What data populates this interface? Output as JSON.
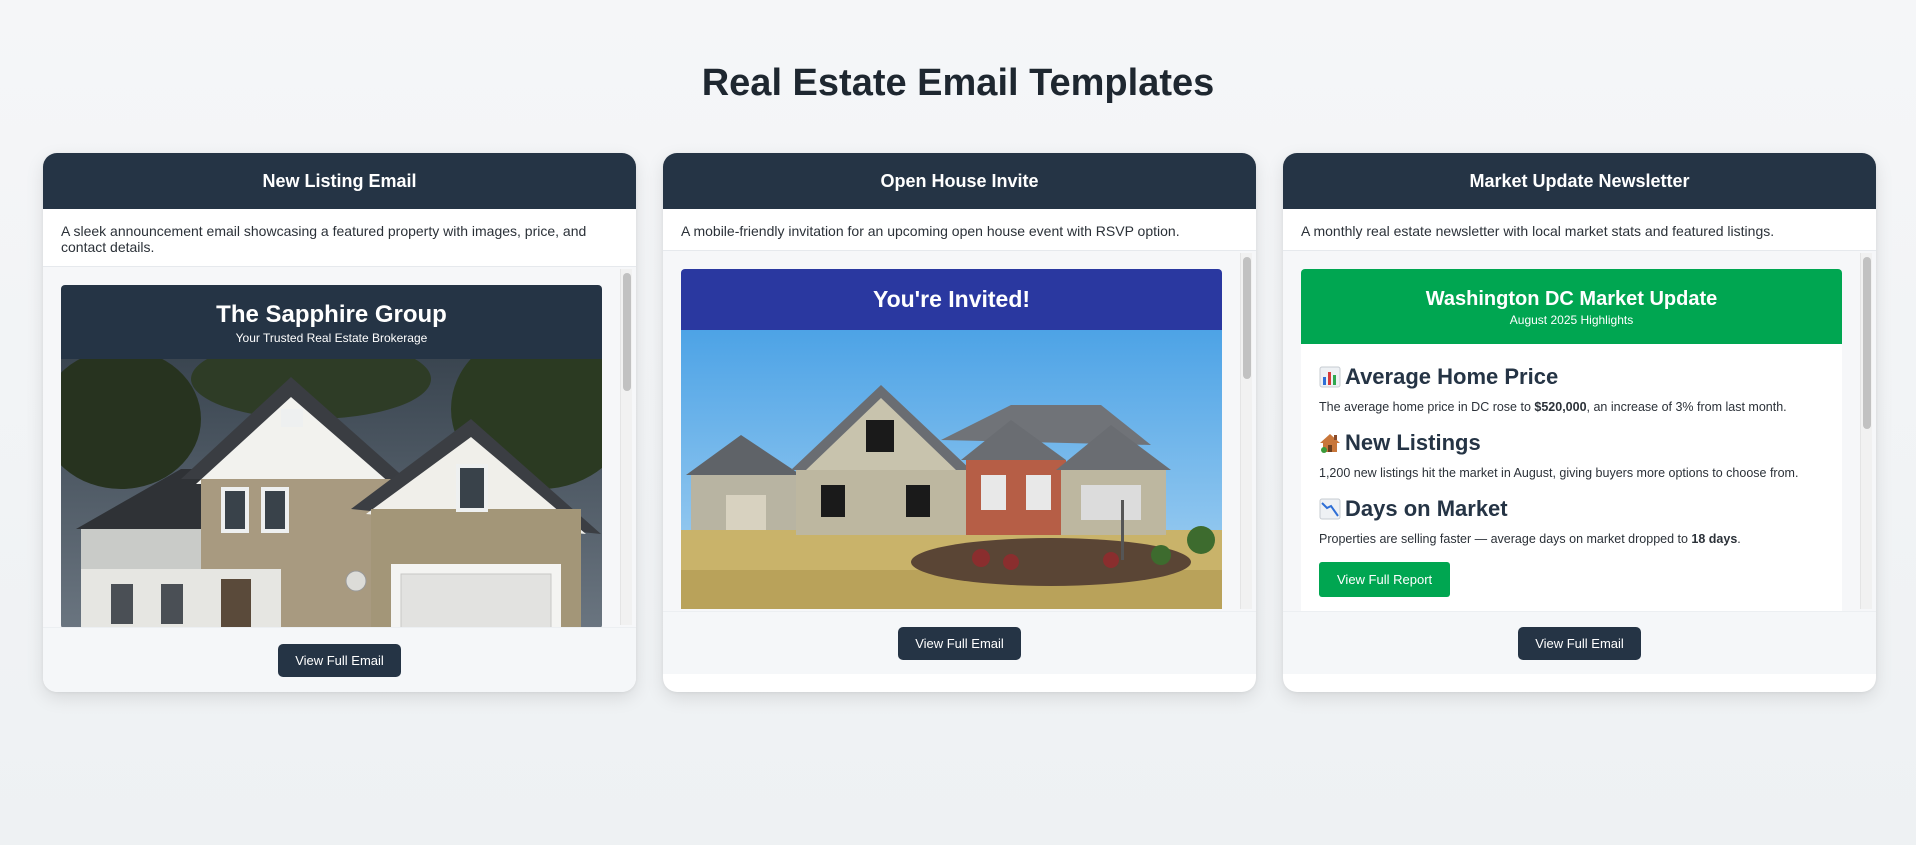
{
  "page": {
    "title": "Real Estate Email Templates"
  },
  "cards": [
    {
      "title": "New Listing Email",
      "description": "A sleek announcement email showcasing a featured property with images, price, and contact details.",
      "email": {
        "brand": "The Sapphire Group",
        "tagline": "Your Trusted Real Estate Brokerage"
      },
      "button": "View Full Email"
    },
    {
      "title": "Open House Invite",
      "description": "A mobile-friendly invitation for an upcoming open house event with RSVP option.",
      "email": {
        "heading": "You're Invited!"
      },
      "button": "View Full Email"
    },
    {
      "title": "Market Update Newsletter",
      "description": "A monthly real estate newsletter with local market stats and featured listings.",
      "email": {
        "heading": "Washington DC Market Update",
        "subheading": "August 2025 Highlights",
        "sections": [
          {
            "icon": "bar-chart-icon",
            "title": "Average Home Price",
            "text_before": "The average home price in DC rose to ",
            "bold": "$520,000",
            "text_after": ", an increase of 3% from last month."
          },
          {
            "icon": "house-icon",
            "title": "New Listings",
            "text_before": "1,200 new listings hit the market in August, giving buyers more options to choose from.",
            "bold": "",
            "text_after": ""
          },
          {
            "icon": "chart-down-icon",
            "title": "Days on Market",
            "text_before": "Properties are selling faster — average days on market dropped to ",
            "bold": "18 days",
            "text_after": "."
          }
        ],
        "cta": "View Full Report"
      },
      "button": "View Full Email"
    }
  ],
  "colors": {
    "navy": "#253445",
    "indigo": "#2a38a0",
    "green": "#00a651"
  }
}
